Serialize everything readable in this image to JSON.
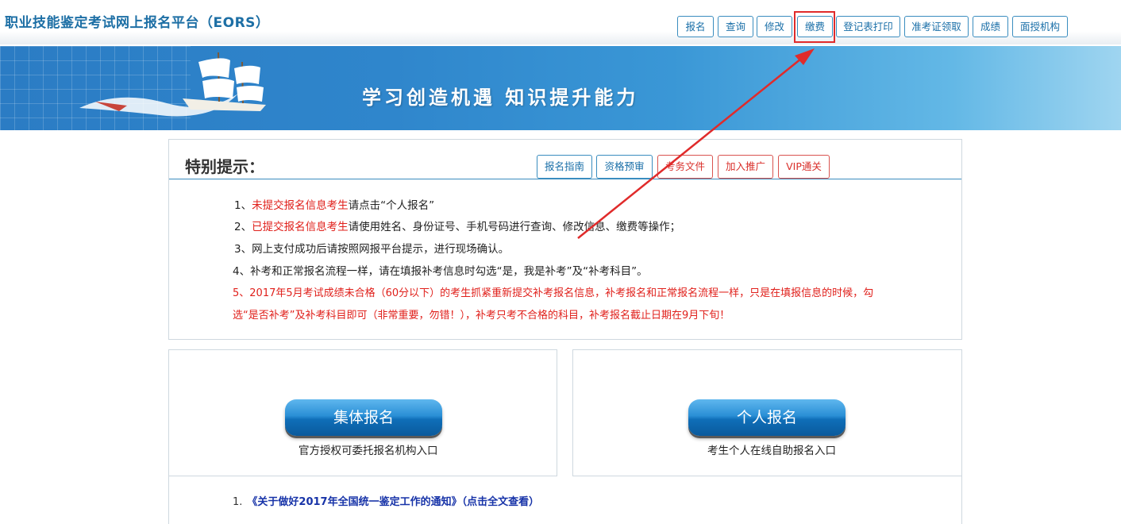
{
  "header": {
    "site_title": "职业技能鉴定考试网上报名平台（EORS）",
    "nav": [
      {
        "label": "报名"
      },
      {
        "label": "查询"
      },
      {
        "label": "修改"
      },
      {
        "label": "缴费"
      },
      {
        "label": "登记表打印"
      },
      {
        "label": "准考证领取"
      },
      {
        "label": "成绩"
      },
      {
        "label": "面授机构"
      }
    ]
  },
  "banner": {
    "slogan": "学习创造机遇  知识提升能力"
  },
  "notice": {
    "title": "特别提示：",
    "buttons": [
      {
        "label": "报名指南",
        "color": "blue"
      },
      {
        "label": "资格预审",
        "color": "blue"
      },
      {
        "label": "考务文件",
        "color": "red"
      },
      {
        "label": "加入推广",
        "color": "red"
      },
      {
        "label": "VIP通关",
        "color": "red"
      }
    ],
    "line1_prefix": "1、",
    "line1_red": "未提交报名信息考生",
    "line1_rest": "请点击“个人报名”",
    "line2_prefix": "2、",
    "line2_red": "已提交报名信息考生",
    "line2_rest": "请使用姓名、身份证号、手机号码进行查询、修改信息、缴费等操作；",
    "line3": "3、网上支付成功后请按照网报平台提示，进行现场确认。",
    "line4": "4、补考和正常报名流程一样，请在填报补考信息时勾选“是，我是补考”及“补考科目”。",
    "line5a": "5、2017年5月考试成绩未合格（60分以下）的考生抓紧重新提交补考报名信息，补考报名和正常报名流程一样，只是在填报信息的时候，勾",
    "line5b": "选“是否补考”及补考科目即可（非常重要，勿错！），补考只考不合格的科目，补考报名截止日期在9月下旬！"
  },
  "register": {
    "group_button": "集体报名",
    "group_caption": "官方授权可委托报名机构入口",
    "personal_button": "个人报名",
    "personal_caption": "考生个人在线自助报名入口"
  },
  "news": {
    "index": "1.",
    "title": "《关于做好2017年全国统一鉴定工作的通知》（点击全文查看）"
  },
  "colors": {
    "accent_blue": "#1d6fa5",
    "highlight_red": "#e02b2b",
    "notice_red": "#e0201b"
  }
}
